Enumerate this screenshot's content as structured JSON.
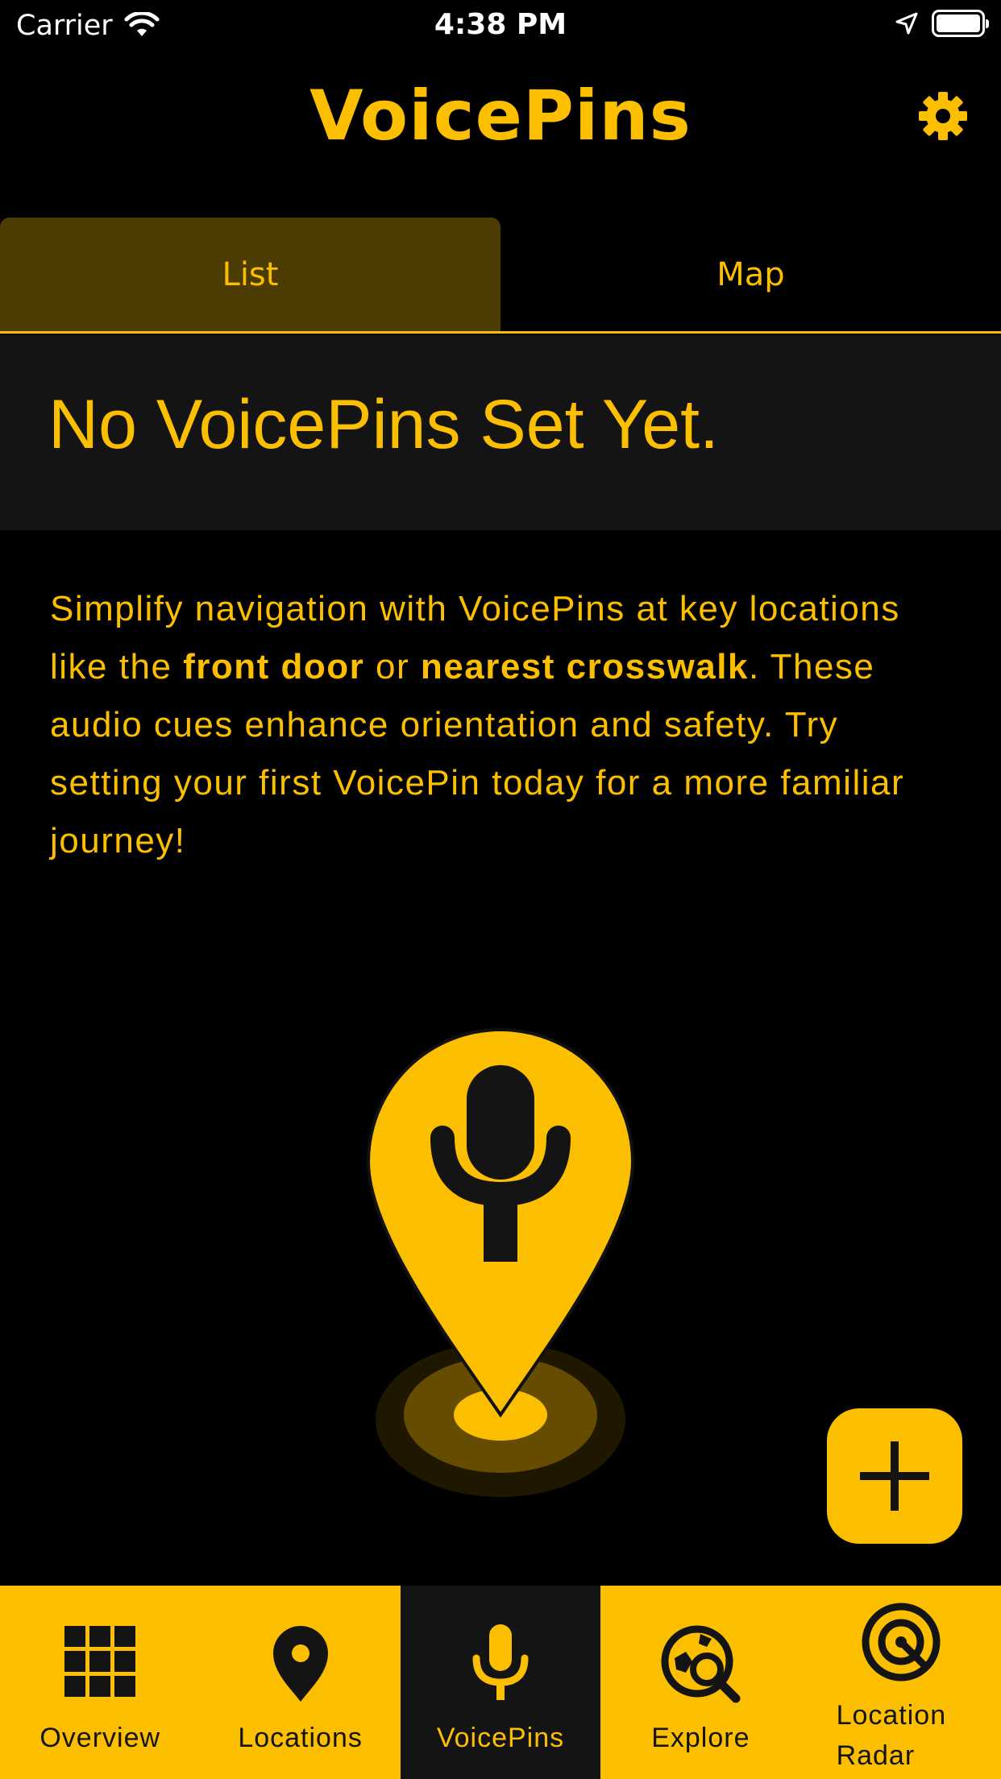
{
  "status_bar": {
    "carrier": "Carrier",
    "time": "4:38 PM"
  },
  "header": {
    "title": "VoicePins"
  },
  "segmented": {
    "list_label": "List",
    "map_label": "Map",
    "selected": "List"
  },
  "empty_state": {
    "title": "No VoicePins Set Yet.",
    "desc_1": "Simplify navigation with VoicePins at key locations like the ",
    "desc_bold_1": "front door",
    "desc_2": " or ",
    "desc_bold_2": "nearest crosswalk",
    "desc_3": ". These audio cues enhance orientation and safety. Try setting your first VoicePin today for a more familiar journey!"
  },
  "colors": {
    "accent": "#fcbf00",
    "background": "#000000",
    "surface": "#141414",
    "selected_segment": "#4d3b04"
  },
  "tab_bar": {
    "items": [
      {
        "label": "Overview",
        "icon": "grid-icon"
      },
      {
        "label": "Locations",
        "icon": "location-pin-icon"
      },
      {
        "label": "VoicePins",
        "icon": "microphone-icon",
        "active": true
      },
      {
        "label": "Explore",
        "icon": "explore-icon"
      },
      {
        "label": "Location\nRadar",
        "icon": "radar-icon"
      }
    ]
  }
}
